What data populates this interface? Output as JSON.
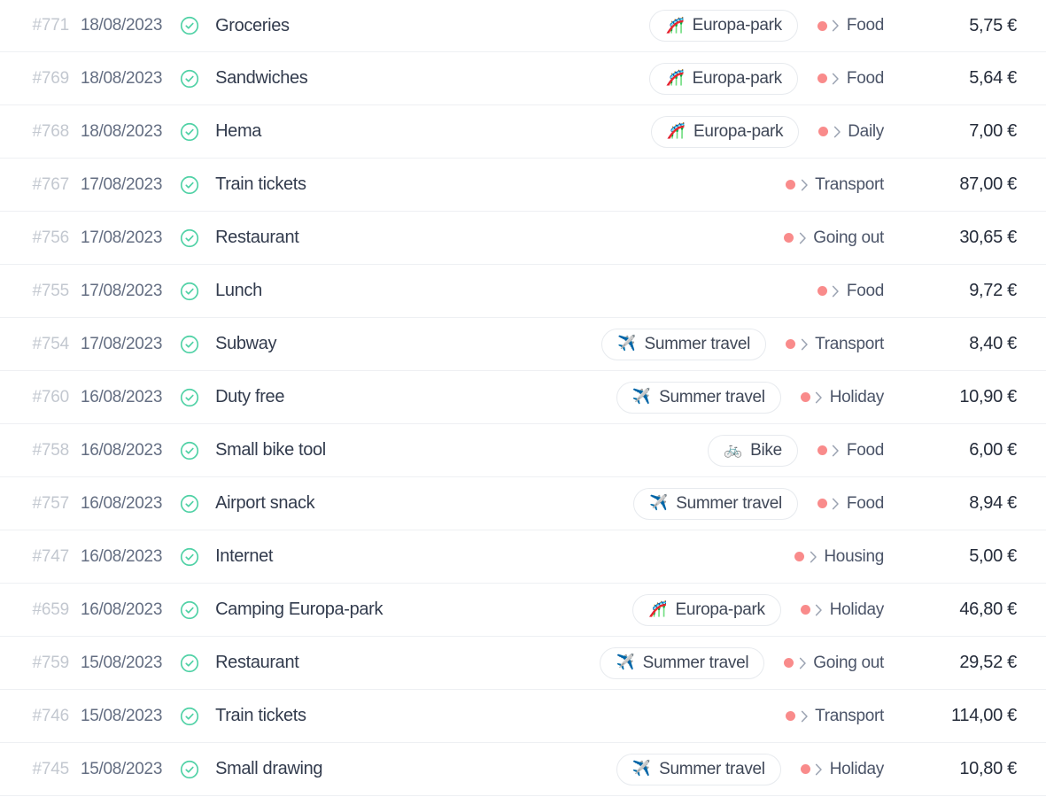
{
  "colors": {
    "status_done": "#4fd1a5",
    "category_dot": "#f98b8b",
    "row_divider": "#eef0f3",
    "id_text": "#c3c8d0",
    "date_text": "#646e82",
    "description_text": "#323b4d",
    "amount_text": "#252c3a",
    "chip_border": "#e7eaee",
    "background": "#ffffff"
  },
  "table": {
    "currency_symbol": "€",
    "category_separator": "›",
    "rows": [
      {
        "id": "#771",
        "date": "18/08/2023",
        "status": "done",
        "status_icon": "check-circle-icon",
        "description": "Groceries",
        "tag": {
          "label": "Europa-park",
          "emoji": "🎢",
          "icon": "rollercoaster-icon"
        },
        "category": "Food",
        "amount": "5,75 €"
      },
      {
        "id": "#769",
        "date": "18/08/2023",
        "status": "done",
        "status_icon": "check-circle-icon",
        "description": "Sandwiches",
        "tag": {
          "label": "Europa-park",
          "emoji": "🎢",
          "icon": "rollercoaster-icon"
        },
        "category": "Food",
        "amount": "5,64 €"
      },
      {
        "id": "#768",
        "date": "18/08/2023",
        "status": "done",
        "status_icon": "check-circle-icon",
        "description": "Hema",
        "tag": {
          "label": "Europa-park",
          "emoji": "🎢",
          "icon": "rollercoaster-icon"
        },
        "category": "Daily",
        "amount": "7,00 €"
      },
      {
        "id": "#767",
        "date": "17/08/2023",
        "status": "done",
        "status_icon": "check-circle-icon",
        "description": "Train tickets",
        "tag": null,
        "category": "Transport",
        "amount": "87,00 €"
      },
      {
        "id": "#756",
        "date": "17/08/2023",
        "status": "done",
        "status_icon": "check-circle-icon",
        "description": "Restaurant",
        "tag": null,
        "category": "Going out",
        "amount": "30,65 €"
      },
      {
        "id": "#755",
        "date": "17/08/2023",
        "status": "done",
        "status_icon": "check-circle-icon",
        "description": "Lunch",
        "tag": null,
        "category": "Food",
        "amount": "9,72 €"
      },
      {
        "id": "#754",
        "date": "17/08/2023",
        "status": "done",
        "status_icon": "check-circle-icon",
        "description": "Subway",
        "tag": {
          "label": "Summer travel",
          "emoji": "✈️",
          "icon": "airplane-icon"
        },
        "category": "Transport",
        "amount": "8,40 €"
      },
      {
        "id": "#760",
        "date": "16/08/2023",
        "status": "done",
        "status_icon": "check-circle-icon",
        "description": "Duty free",
        "tag": {
          "label": "Summer travel",
          "emoji": "✈️",
          "icon": "airplane-icon"
        },
        "category": "Holiday",
        "amount": "10,90 €"
      },
      {
        "id": "#758",
        "date": "16/08/2023",
        "status": "done",
        "status_icon": "check-circle-icon",
        "description": "Small bike tool",
        "tag": {
          "label": "Bike",
          "emoji": "🚲",
          "icon": "bicycle-icon"
        },
        "category": "Food",
        "amount": "6,00 €"
      },
      {
        "id": "#757",
        "date": "16/08/2023",
        "status": "done",
        "status_icon": "check-circle-icon",
        "description": "Airport snack",
        "tag": {
          "label": "Summer travel",
          "emoji": "✈️",
          "icon": "airplane-icon"
        },
        "category": "Food",
        "amount": "8,94 €"
      },
      {
        "id": "#747",
        "date": "16/08/2023",
        "status": "done",
        "status_icon": "check-circle-icon",
        "description": "Internet",
        "tag": null,
        "category": "Housing",
        "amount": "5,00 €"
      },
      {
        "id": "#659",
        "date": "16/08/2023",
        "status": "done",
        "status_icon": "check-circle-icon",
        "description": "Camping Europa-park",
        "tag": {
          "label": "Europa-park",
          "emoji": "🎢",
          "icon": "rollercoaster-icon"
        },
        "category": "Holiday",
        "amount": "46,80 €"
      },
      {
        "id": "#759",
        "date": "15/08/2023",
        "status": "done",
        "status_icon": "check-circle-icon",
        "description": "Restaurant",
        "tag": {
          "label": "Summer travel",
          "emoji": "✈️",
          "icon": "airplane-icon"
        },
        "category": "Going out",
        "amount": "29,52 €"
      },
      {
        "id": "#746",
        "date": "15/08/2023",
        "status": "done",
        "status_icon": "check-circle-icon",
        "description": "Train tickets",
        "tag": null,
        "category": "Transport",
        "amount": "114,00 €"
      },
      {
        "id": "#745",
        "date": "15/08/2023",
        "status": "done",
        "status_icon": "check-circle-icon",
        "description": "Small drawing",
        "tag": {
          "label": "Summer travel",
          "emoji": "✈️",
          "icon": "airplane-icon"
        },
        "category": "Holiday",
        "amount": "10,80 €"
      }
    ]
  }
}
